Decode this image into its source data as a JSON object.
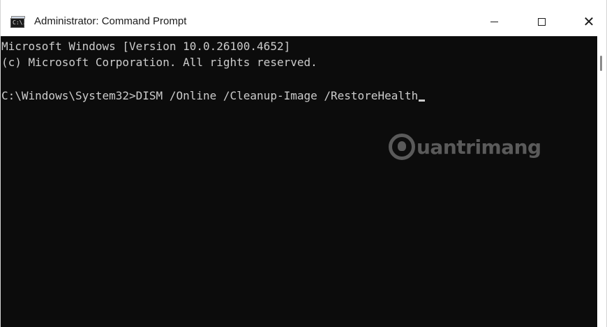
{
  "window": {
    "title": "Administrator: Command Prompt",
    "app_icon_text": "C:\\.",
    "controls": {
      "minimize_icon": "minimize-icon",
      "maximize_icon": "maximize-icon",
      "close_icon": "close-icon",
      "close_glyph": "✕"
    }
  },
  "console": {
    "lines": [
      "Microsoft Windows [Version 10.0.26100.4652]",
      "(c) Microsoft Corporation. All rights reserved.",
      "",
      "C:\\Windows\\System32>DISM /Online /Cleanup-Image /RestoreHealth"
    ],
    "background": "#0c0c0c",
    "foreground": "#cccccc"
  },
  "watermark": {
    "text": "uantrimang"
  }
}
